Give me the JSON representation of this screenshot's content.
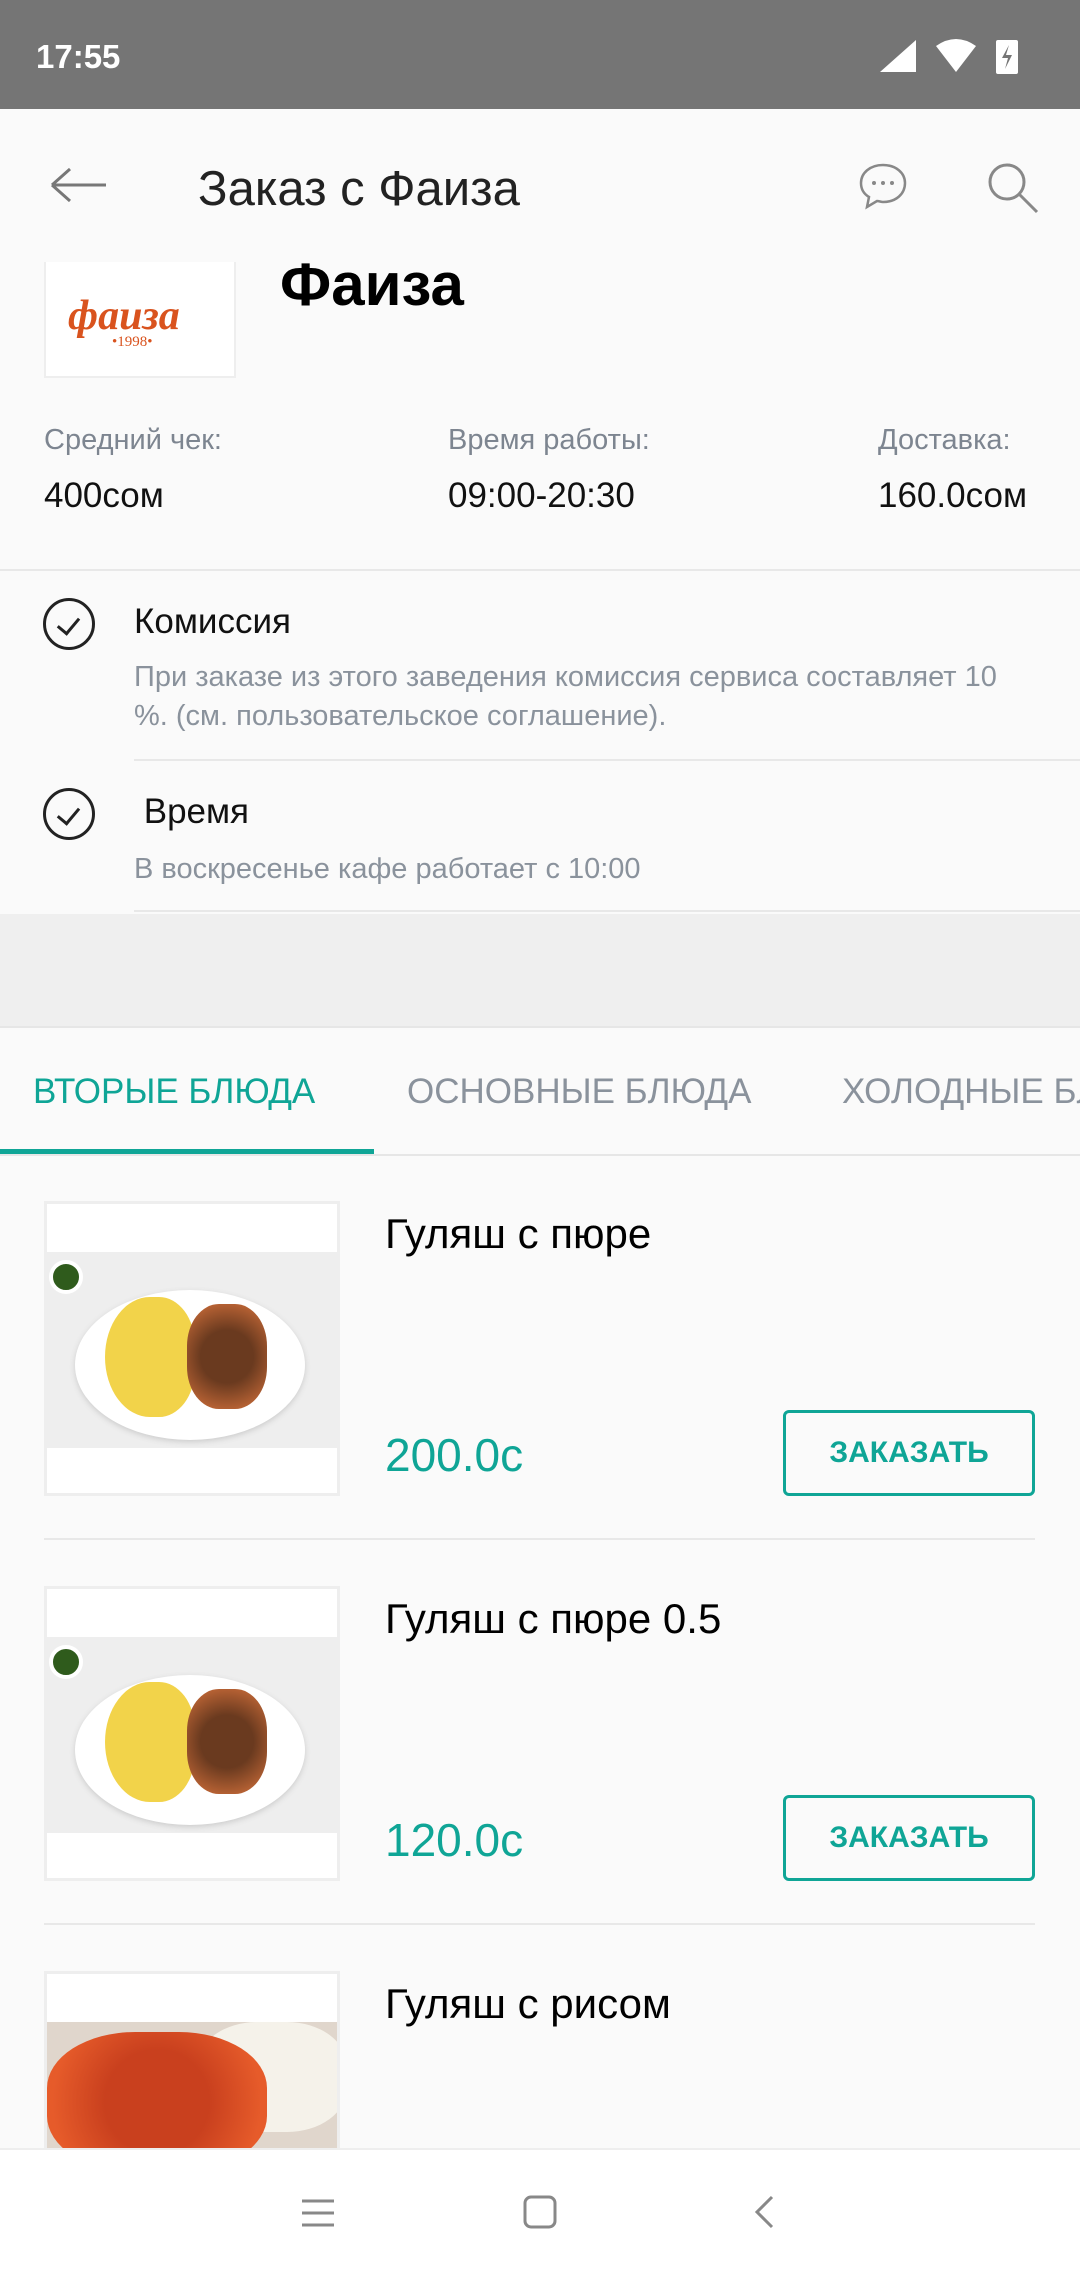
{
  "status_bar": {
    "time": "17:55"
  },
  "app_bar": {
    "title": "Заказ с Фаиза"
  },
  "restaurant": {
    "name": "Фаиза",
    "logo_text": "фаиза",
    "logo_year": "•1998•",
    "info": [
      {
        "label": "Средний чек:",
        "value": "400сом"
      },
      {
        "label": "Время работы:",
        "value": "09:00-20:30"
      },
      {
        "label": "Доставка:",
        "value": "160.0сом"
      }
    ]
  },
  "notices": [
    {
      "title": "Комиссия",
      "desc": "При заказе из этого заведения комиссия сервиса составляет 10 %. (см. пользовательское соглашение)."
    },
    {
      "title": " Время",
      "desc": "В воскресенье кафе работает с 10:00"
    }
  ],
  "tabs": [
    "ВТОРЫЕ БЛЮДА",
    "ОСНОВНЫЕ БЛЮДА",
    "ХОЛОДНЫЕ БЛЮДА"
  ],
  "items": [
    {
      "name": "Гуляш с пюре",
      "price": "200.0с",
      "button": "ЗАКАЗАТЬ"
    },
    {
      "name": "Гуляш с пюре 0.5",
      "price": "120.0с",
      "button": "ЗАКАЗАТЬ"
    },
    {
      "name": "Гуляш с рисом"
    }
  ],
  "colors": {
    "accent": "#0fa596",
    "status_bar": "#757575"
  }
}
